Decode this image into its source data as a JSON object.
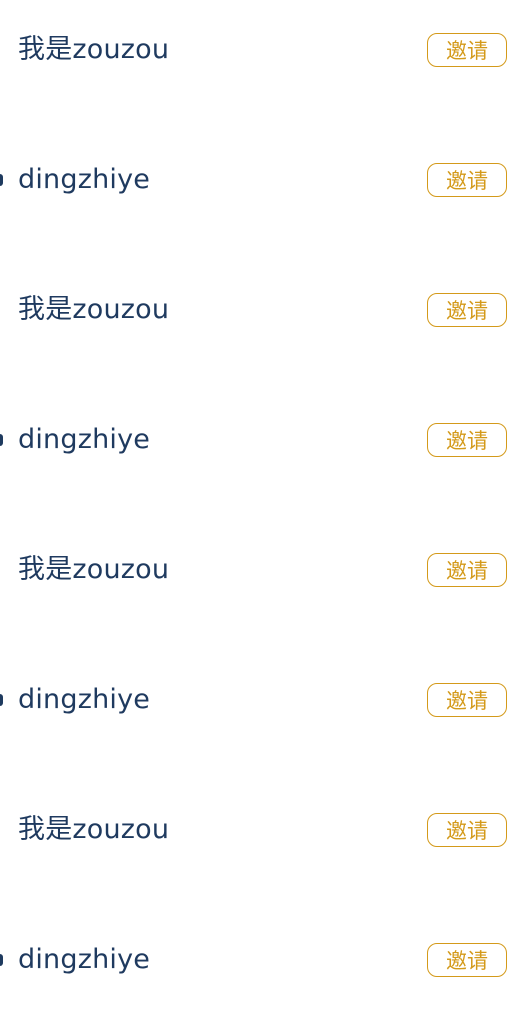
{
  "invite_list": {
    "button_label": "邀请",
    "items": [
      {
        "name": "我是zouzou"
      },
      {
        "name": "dingzhiye"
      },
      {
        "name": "我是zouzou"
      },
      {
        "name": "dingzhiye"
      },
      {
        "name": "我是zouzou"
      },
      {
        "name": "dingzhiye"
      },
      {
        "name": "我是zouzou"
      },
      {
        "name": "dingzhiye"
      }
    ]
  },
  "colors": {
    "name_text": "#1f3a5f",
    "accent": "#d49a1a",
    "background": "#ffffff"
  }
}
